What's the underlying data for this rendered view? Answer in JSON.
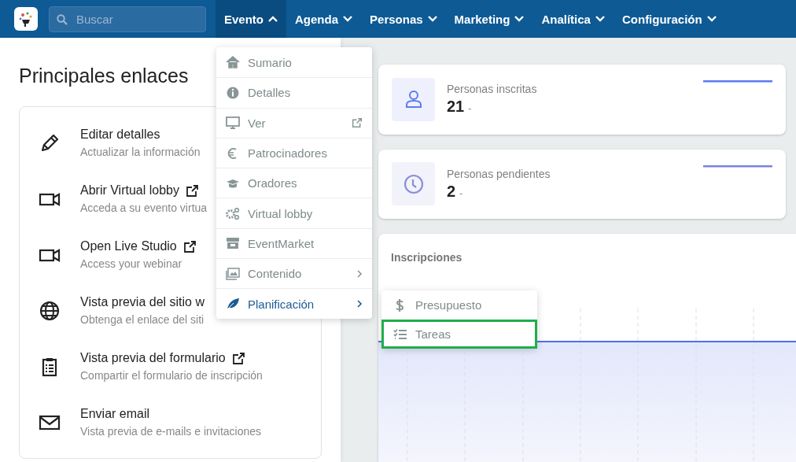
{
  "nav": {
    "search": {
      "placeholder": "Buscar"
    },
    "items": [
      {
        "label": "Evento",
        "selected": true,
        "expanded": true
      },
      {
        "label": "Agenda",
        "selected": false,
        "expanded": false
      },
      {
        "label": "Personas",
        "selected": false,
        "expanded": false
      },
      {
        "label": "Marketing",
        "selected": false,
        "expanded": false
      },
      {
        "label": "Analítica",
        "selected": false,
        "expanded": false
      },
      {
        "label": "Configuración",
        "selected": false,
        "expanded": false
      }
    ]
  },
  "main_links": {
    "title": "Principales enlaces",
    "items": [
      {
        "title": "Editar detalles",
        "description": "Actualizar la información",
        "external": false
      },
      {
        "title": "Abrir Virtual lobby",
        "description": "Acceda a su evento virtua",
        "external": true
      },
      {
        "title": "Open Live Studio",
        "description": "Access your webinar",
        "external": true
      },
      {
        "title": "Vista previa del sitio w",
        "description": "Obtenga el enlace del siti",
        "external": false
      },
      {
        "title": "Vista previa del formulario",
        "description": "Compartir el formulario de inscripción",
        "external": true
      },
      {
        "title": "Enviar email",
        "description": "Vista previa de e-mails e invitaciones",
        "external": false
      }
    ]
  },
  "stats": [
    {
      "label": "Personas inscritas",
      "value": "21",
      "change": "-"
    },
    {
      "label": "Personas pendientes",
      "value": "2",
      "change": "-"
    }
  ],
  "registrations": {
    "title": "Inscripciones"
  },
  "event_menu": {
    "items": [
      {
        "label": "Sumario",
        "selected": false,
        "external": false,
        "submenu": false
      },
      {
        "label": "Detalles",
        "selected": false,
        "external": false,
        "submenu": false
      },
      {
        "label": "Ver",
        "selected": false,
        "external": true,
        "submenu": false
      },
      {
        "label": "Patrocinadores",
        "selected": false,
        "external": false,
        "submenu": false
      },
      {
        "label": "Oradores",
        "selected": false,
        "external": false,
        "submenu": false
      },
      {
        "label": "Virtual lobby",
        "selected": false,
        "external": false,
        "submenu": false
      },
      {
        "label": "EventMarket",
        "selected": false,
        "external": false,
        "submenu": false
      },
      {
        "label": "Contenido",
        "selected": false,
        "external": false,
        "submenu": true
      },
      {
        "label": "Planificación",
        "selected": true,
        "external": false,
        "submenu": true
      }
    ]
  },
  "planning_submenu": {
    "items": [
      {
        "label": "Presupuesto",
        "selected": false
      },
      {
        "label": "Tareas",
        "selected": true
      }
    ]
  }
}
